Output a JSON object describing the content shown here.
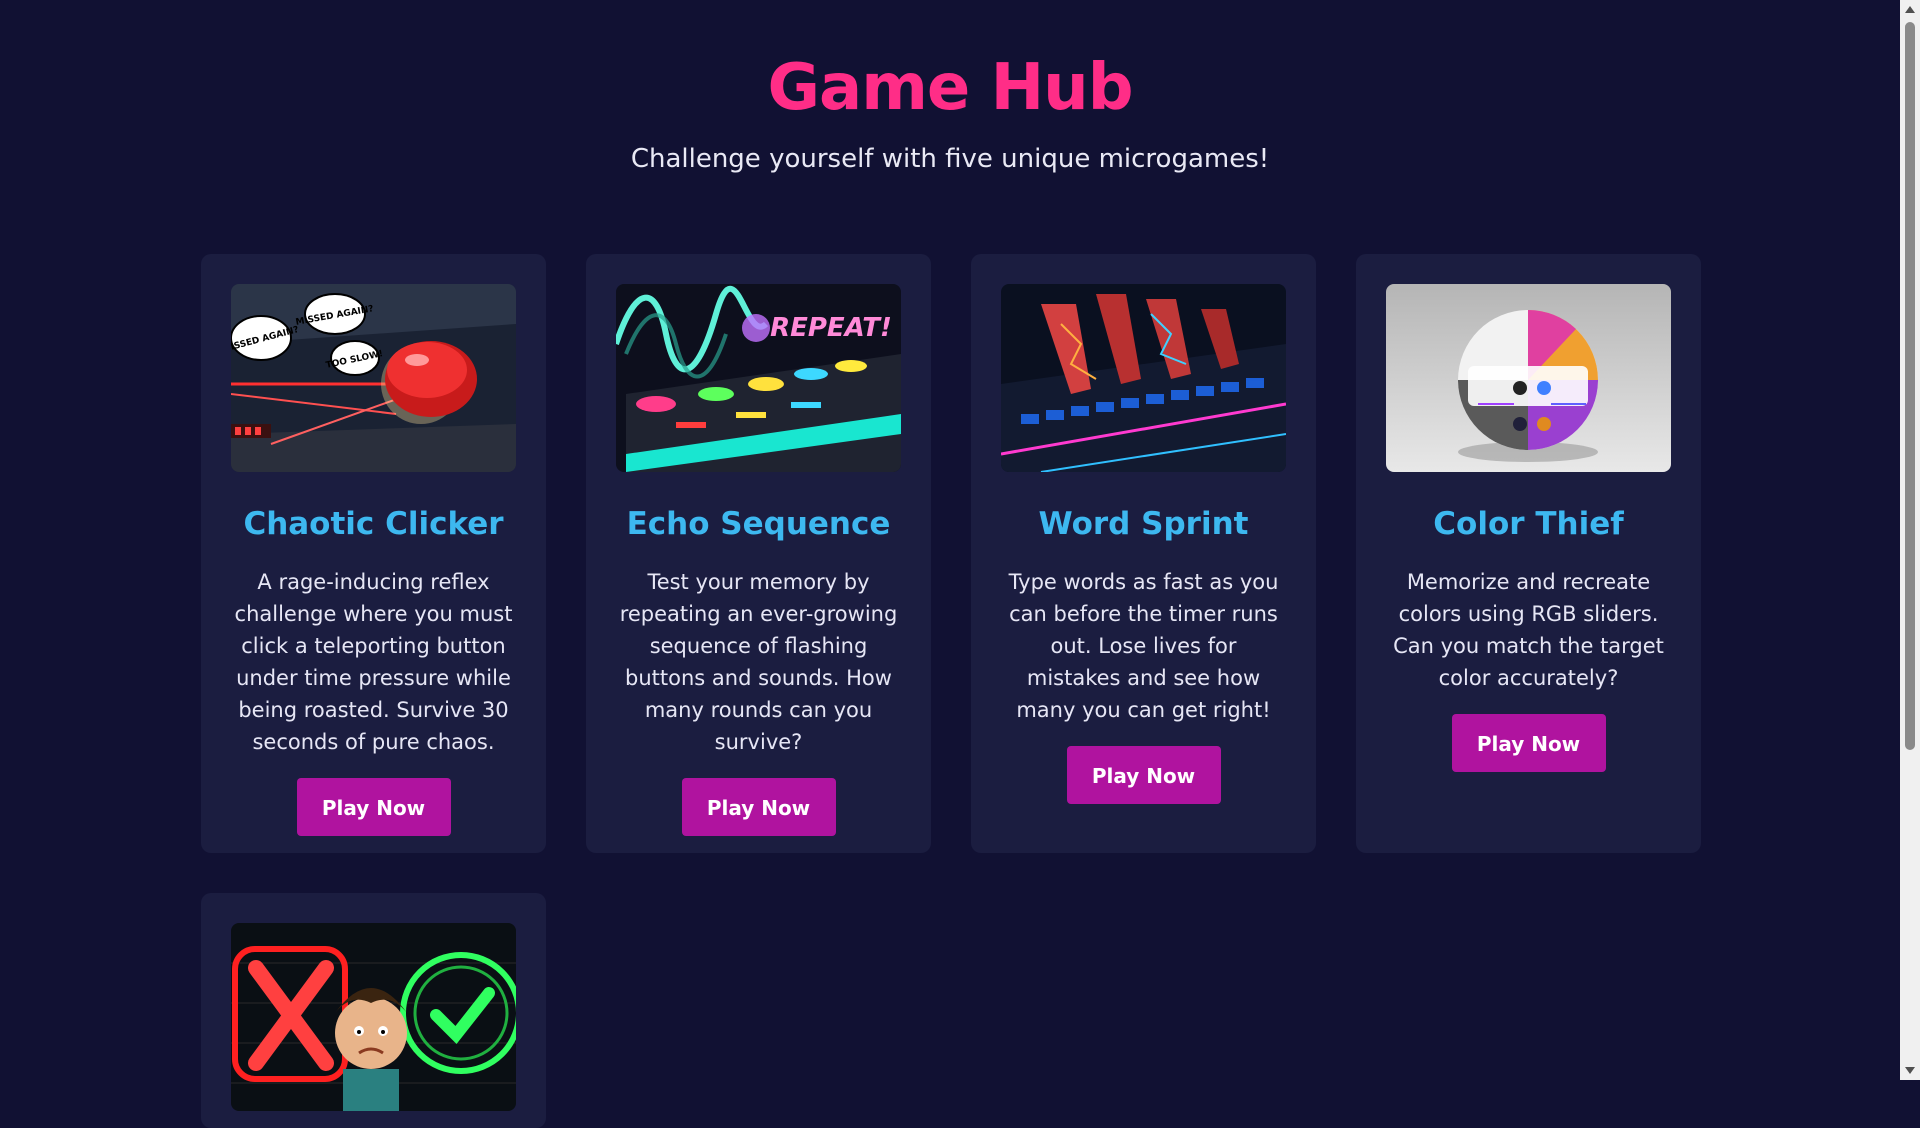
{
  "header": {
    "title": "Game Hub",
    "subtitle": "Challenge yourself with five unique microgames!"
  },
  "colors": {
    "background": "#111133",
    "card": "#1b1d40",
    "title": "#ff2d87",
    "card_title": "#3db8f0",
    "button": "#b0139f"
  },
  "games": [
    {
      "title": "Chaotic Clicker",
      "description": "A rage-inducing reflex challenge where you must click a teleporting button under time pressure while being roasted. Survive 30 seconds of pure chaos.",
      "button": "Play Now",
      "image_text": [
        "MISSED AGAIN?",
        "MISSED AGAIN?",
        "TOO SLOW!"
      ]
    },
    {
      "title": "Echo Sequence",
      "description": "Test your memory by repeating an ever-growing sequence of flashing buttons and sounds. How many rounds can you survive?",
      "button": "Play Now",
      "image_text": [
        "REPEAT!"
      ]
    },
    {
      "title": "Word Sprint",
      "description": "Type words as fast as you can before the timer runs out. Lose lives for mistakes and see how many you can get right!",
      "button": "Play Now"
    },
    {
      "title": "Color Thief",
      "description": "Memorize and recreate colors using RGB sliders. Can you match the target color accurately?",
      "button": "Play Now"
    },
    {
      "title": "",
      "description": "",
      "button": ""
    }
  ]
}
